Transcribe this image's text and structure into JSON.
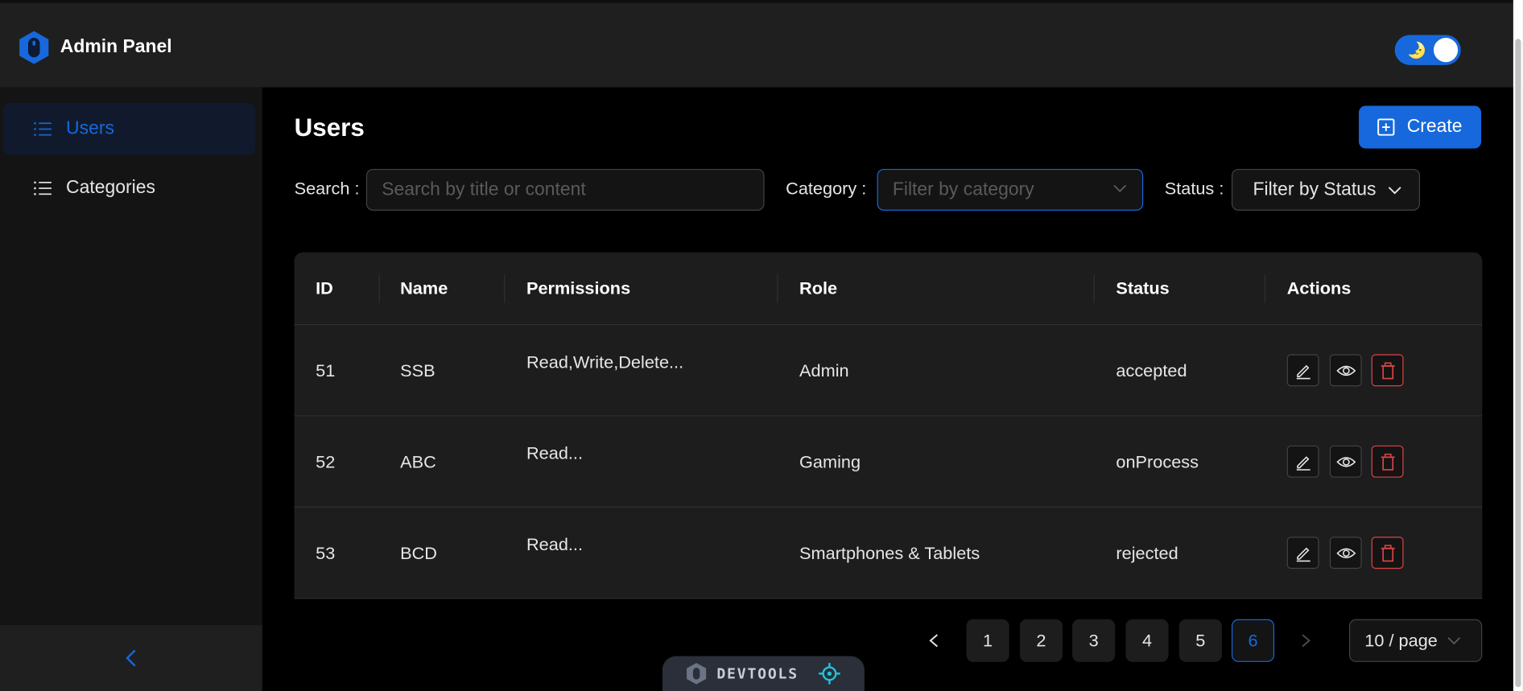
{
  "app": {
    "title": "Admin Panel"
  },
  "theme_toggle": {
    "icon": "moon-icon"
  },
  "sidebar": {
    "items": [
      {
        "label": "Users",
        "icon": "list-icon",
        "active": true
      },
      {
        "label": "Categories",
        "icon": "list-icon",
        "active": false
      }
    ],
    "collapse_icon": "chevron-left-icon"
  },
  "main": {
    "title": "Users",
    "create_label": "Create",
    "filters": {
      "search_label": "Search",
      "search_placeholder": "Search by title or content",
      "category_label": "Category",
      "category_placeholder": "Filter by category",
      "status_label": "Status",
      "status_value": "Filter by Status"
    }
  },
  "table": {
    "columns": [
      "ID",
      "Name",
      "Permissions",
      "Role",
      "Status",
      "Actions"
    ],
    "rows": [
      {
        "id": "51",
        "name": "SSB",
        "permissions": "Read,Write,Delete...",
        "role": "Admin",
        "status": "accepted"
      },
      {
        "id": "52",
        "name": "ABC",
        "permissions": "Read...",
        "role": "Gaming",
        "status": "onProcess"
      },
      {
        "id": "53",
        "name": "BCD",
        "permissions": "Read...",
        "role": "Smartphones & Tablets",
        "status": "rejected"
      }
    ]
  },
  "pagination": {
    "pages": [
      "1",
      "2",
      "3",
      "4",
      "5",
      "6"
    ],
    "current": "6",
    "page_size": "10 / page"
  },
  "devtools": {
    "label": "DEVTOOLS"
  },
  "colors": {
    "accent": "#1668dc",
    "danger": "#dc4446",
    "background": "#000000",
    "surface": "#1d1d1d"
  }
}
